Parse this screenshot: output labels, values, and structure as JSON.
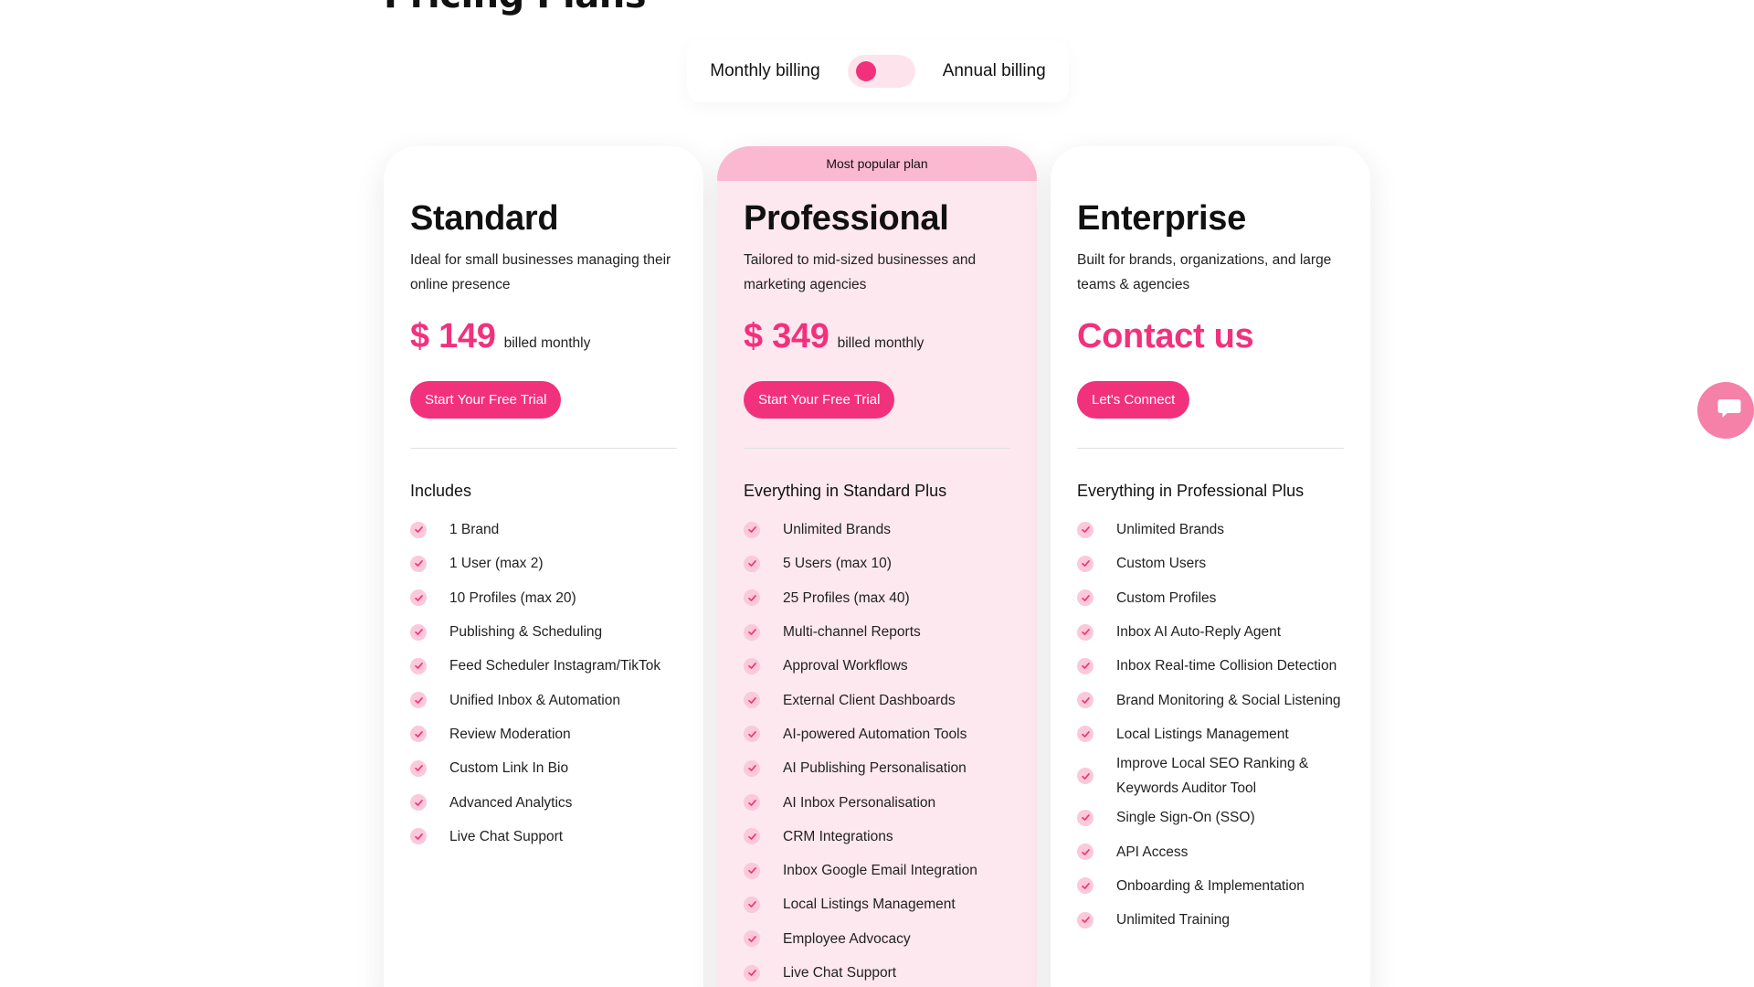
{
  "page": {
    "title": "Pricing Plans"
  },
  "billing": {
    "monthly_label": "Monthly billing",
    "annual_label": "Annual billing",
    "selected": "monthly"
  },
  "plans": [
    {
      "name": "Standard",
      "description": "Ideal for small businesses managing their online presence",
      "price": "$ 149",
      "price_note": "billed monthly",
      "cta": "Start Your Free Trial",
      "features_heading": "Includes",
      "features": [
        "1 Brand",
        "1 User (max 2)",
        "10 Profiles (max 20)",
        "Publishing & Scheduling",
        "Feed Scheduler Instagram/TikTok",
        "Unified Inbox & Automation",
        "Review Moderation",
        "Custom Link In Bio",
        "Advanced Analytics",
        "Live Chat Support"
      ]
    },
    {
      "badge": "Most popular plan",
      "name": "Professional",
      "description": "Tailored to mid-sized businesses and marketing agencies",
      "price": "$ 349",
      "price_note": "billed monthly",
      "cta": "Start Your Free Trial",
      "features_heading": "Everything in Standard Plus",
      "features": [
        "Unlimited Brands",
        "5 Users (max 10)",
        "25 Profiles (max 40)",
        "Multi-channel Reports",
        "Approval Workflows",
        "External Client Dashboards",
        "AI-powered Automation Tools",
        "AI Publishing Personalisation",
        "AI Inbox Personalisation",
        "CRM Integrations",
        "Inbox Google Email Integration",
        "Local Listings Management",
        "Employee Advocacy",
        "Live Chat Support"
      ]
    },
    {
      "name": "Enterprise",
      "description": "Built for brands, organizations, and large teams & agencies",
      "price": "Contact us",
      "price_note": "",
      "cta": "Let's Connect",
      "features_heading": "Everything in Professional Plus",
      "features": [
        "Unlimited Brands",
        "Custom Users",
        "Custom Profiles",
        "Inbox AI Auto-Reply Agent",
        "Inbox Real-time Collision Detection",
        "Brand Monitoring & Social Listening",
        "Local Listings Management",
        "Improve Local SEO Ranking & Keywords Auditor Tool",
        "Single Sign-On (SSO)",
        "API Access",
        "Onboarding & Implementation",
        "Unlimited Training"
      ]
    }
  ],
  "icons": {
    "check": "check-icon",
    "chat": "chat-icon"
  },
  "colors": {
    "accent": "#f2317d",
    "accent_light": "#fde4ec",
    "popular_bg": "#fde8ef",
    "badge_bg": "#fbb9d1"
  }
}
